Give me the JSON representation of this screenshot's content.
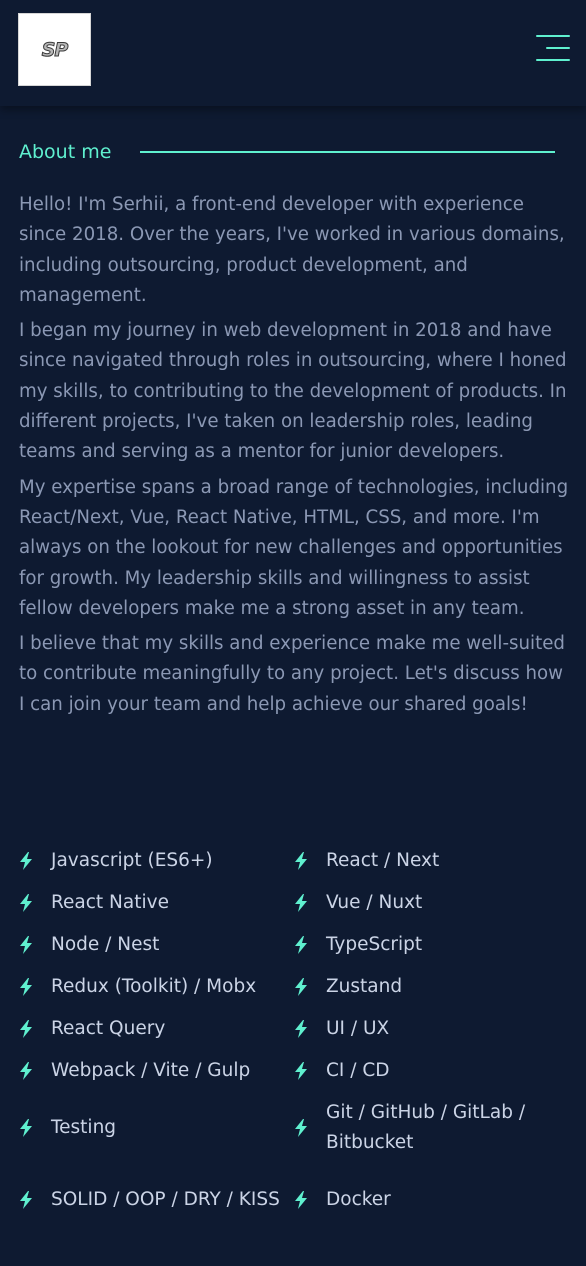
{
  "header": {
    "logo_text": "SP",
    "menu_icon": "hamburger-menu-icon"
  },
  "about": {
    "title": "About me",
    "paragraphs": [
      "Hello! I'm Serhii, a front-end developer with experience since 2018. Over the years, I've worked in various domains, including outsourcing, product development, and management.",
      "I began my journey in web development in 2018 and have since navigated through roles in outsourcing, where I honed my skills, to contributing to the development of products. In different projects, I've taken on leadership roles, leading teams and serving as a mentor for junior developers.",
      "My expertise spans a broad range of technologies, including React/Next, Vue, React Native, HTML, CSS, and more. I'm always on the lookout for new challenges and opportunities for growth. My leadership skills and willingness to assist fellow developers make me a strong asset in any team.",
      "I believe that my skills and experience make me well-suited to contribute meaningfully to any project. Let's discuss how I can join your team and help achieve our shared goals!"
    ]
  },
  "skills": [
    "Javascript (ES6+)",
    "React / Next",
    "React Native",
    "Vue / Nuxt",
    "Node / Nest",
    "TypeScript",
    "Redux (Toolkit) / Mobx",
    "Zustand",
    "React Query",
    "UI / UX",
    "Webpack / Vite / Gulp",
    "CI / CD",
    "Testing",
    "Git / GitHub / GitLab / Bitbucket",
    "SOLID / OOP / DRY / KISS",
    "Docker"
  ],
  "colors": {
    "background": "#0e1a31",
    "accent": "#5ff0cf",
    "body_text": "#8b98b4",
    "skill_text": "#cbd4e6"
  }
}
